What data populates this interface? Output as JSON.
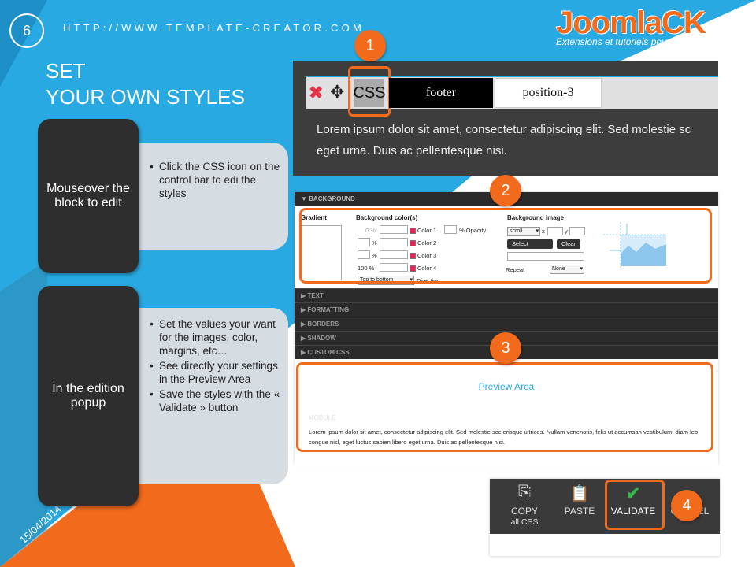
{
  "slide": {
    "number": "6",
    "url": "HTTP://WWW.TEMPLATE-CREATOR.COM",
    "logo_text": "JoomlaCK",
    "logo_tagline": "Extensions et tutoriels pour Joomla!®",
    "title_line1": "SET",
    "title_line2": "YOUR OWN STYLES",
    "date": "15/04/2014"
  },
  "steps": [
    {
      "heading": "Mouseover the block to edit",
      "bullets": [
        "Click the CSS icon on the control bar to edi the styles"
      ]
    },
    {
      "heading": "In the edition popup",
      "bullets": [
        "Set the values your want for the images, color, margins, etc…",
        "See directly  your settings in the Preview Area",
        "Save the styles with the « Validate » button"
      ]
    }
  ],
  "markers": [
    "1",
    "2",
    "3",
    "4"
  ],
  "panel1": {
    "css_label": "CSS",
    "tab1": "footer",
    "tab2": "position-3",
    "lorem": "Lorem ipsum dolor sit amet, consectetur adipiscing elit. Sed molestie sc",
    "lorem2": "eget urna. Duis ac pellentesque nisi."
  },
  "panel2": {
    "header": "▼ BACKGROUND",
    "gradient_label": "Gradient",
    "bgcolor_label": "Background color(s)",
    "bgimage_label": "Background image",
    "opacity_label": "% Opacity",
    "color1": "Color 1",
    "color2": "Color 2",
    "color3": "Color 3",
    "color4": "Color 4",
    "pct1": "0 %",
    "pct2": "%",
    "pct3": "%",
    "pct4": "100 %",
    "direction_value": "Top to bottom",
    "direction_label": "Direction",
    "scroll_value": "scroll",
    "x_label": "x",
    "y_label": "y",
    "select_btn": "Select",
    "clear_btn": "Clear",
    "repeat_label": "Repeat",
    "repeat_value": "None",
    "sections": [
      "▶ TEXT",
      "▶ FORMATTING",
      "▶ BORDERS",
      "▶ SHADOW",
      "▶ CUSTOM CSS"
    ],
    "preview_title": "Preview Area",
    "module_label": "MODULE",
    "preview_lorem": "Lorem ipsum dolor sit amet, consectetur adipiscing elit. Sed molestie scelerisque ultrices. Nullam venenatis, felis ut accumsan vestibulum, diam leo congue nisl, eget luctus sapien libero eget urna. Duis ac pellentesque nisi."
  },
  "panel4": {
    "copy_label": "COPY",
    "copy_sub": "all CSS",
    "paste_label": "PASTE",
    "validate_label": "VALIDATE",
    "cancel_label": "CANCEL"
  },
  "colors": {
    "blue": "#29a9e1",
    "orange": "#f26a1b",
    "dark": "#2e2e2e",
    "light": "#d6dde2",
    "check_green": "#36b54a"
  }
}
